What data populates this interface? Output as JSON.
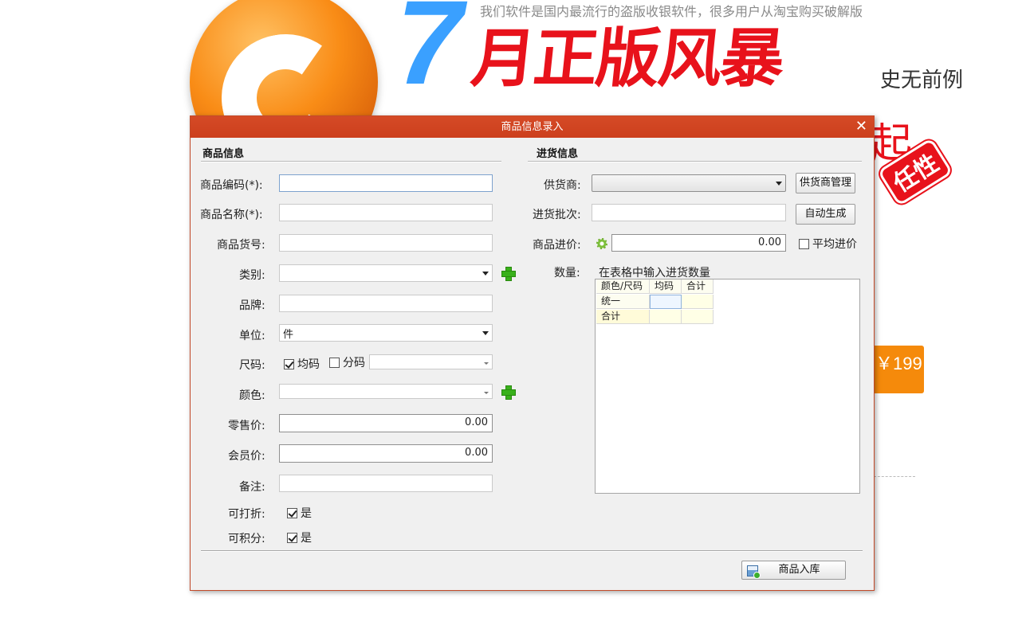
{
  "promo": {
    "tagline": "我们软件是国内最流行的盗版收银软件，很多用户从淘宝购买破解版",
    "seven": "7",
    "headline": "月正版风暴",
    "subhead": "史无前例",
    "partial_char": "起",
    "stamp": "任性",
    "price": "￥199"
  },
  "dialog": {
    "title": "商品信息录入",
    "close_glyph": "✕",
    "left_section_title": "商品信息",
    "right_section_title": "进货信息",
    "fields": {
      "code_label": "商品编码(*):",
      "name_label": "商品名称(*):",
      "item_no_label": "商品货号:",
      "category_label": "类别:",
      "brand_label": "品牌:",
      "unit_label": "单位:",
      "unit_value": "件",
      "size_label": "尺码:",
      "size_uniform": "均码",
      "size_split": "分码",
      "color_label": "颜色:",
      "retail_label": "零售价:",
      "retail_value": "0.00",
      "member_label": "会员价:",
      "member_value": "0.00",
      "remark_label": "备注:",
      "discount_label": "可打折:",
      "discount_value": "是",
      "points_label": "可积分:",
      "points_value": "是"
    },
    "purchase": {
      "supplier_label": "供货商:",
      "supplier_button": "供货商管理",
      "batch_label": "进货批次:",
      "batch_button": "自动生成",
      "cost_label": "商品进价:",
      "cost_value": "0.00",
      "avg_cost": "平均进价",
      "qty_label": "数量:",
      "qty_hint": "在表格中输入进货数量",
      "grid": {
        "headers": [
          "颜色/尺码",
          "均码",
          "合计"
        ],
        "rows": [
          [
            "统一",
            "",
            ""
          ],
          [
            "合计",
            "",
            ""
          ]
        ]
      }
    },
    "submit_button": "商品入库"
  }
}
